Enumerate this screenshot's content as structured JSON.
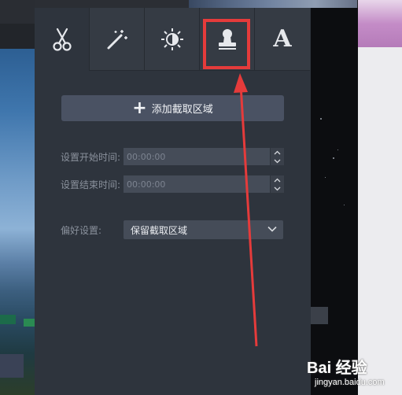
{
  "toolbar": {
    "tabs": [
      {
        "id": "cut",
        "icon": "scissors-icon",
        "active": true
      },
      {
        "id": "effects",
        "icon": "magic-wand-icon",
        "active": false
      },
      {
        "id": "adjust",
        "icon": "brightness-icon",
        "active": false
      },
      {
        "id": "watermark",
        "icon": "stamp-icon",
        "active": false
      },
      {
        "id": "text",
        "icon": "text-icon",
        "active": false,
        "glyph": "A"
      }
    ]
  },
  "clip": {
    "add_button_label": "添加截取区域",
    "start_label": "设置开始时间:",
    "start_value": "00:00:00",
    "end_label": "设置结束时间:",
    "end_value": "00:00:00",
    "preference_label": "偏好设置:",
    "preference_value": "保留截取区域"
  },
  "watermark_overlay": {
    "logo": "Bai 经验",
    "url": "jingyan.baidu.com"
  },
  "colors": {
    "panel_bg": "#2e343d",
    "highlight": "#e53b3b",
    "button_bg": "#4a5263"
  }
}
